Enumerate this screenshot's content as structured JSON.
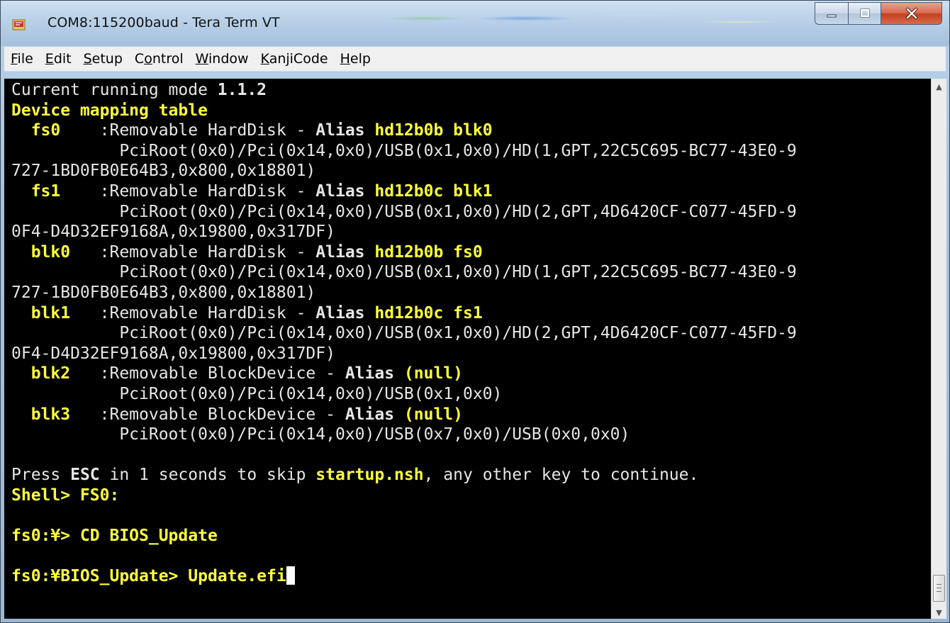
{
  "window": {
    "title": "COM8:115200baud - Tera Term VT"
  },
  "menu": {
    "items": [
      {
        "u": "F",
        "rest": "ile"
      },
      {
        "u": "E",
        "rest": "dit"
      },
      {
        "u": "S",
        "rest": "etup"
      },
      {
        "pre": "C",
        "u": "o",
        "rest": "ntrol"
      },
      {
        "u": "W",
        "rest": "indow"
      },
      {
        "u": "K",
        "rest": "anjiCode"
      },
      {
        "u": "H",
        "rest": "elp"
      }
    ]
  },
  "terminal": {
    "lines": [
      [
        {
          "t": "Current running mode ",
          "c": "w"
        },
        {
          "t": "1.1.2",
          "c": "w",
          "b": true
        }
      ],
      [
        {
          "t": "Device mapping table",
          "c": "y",
          "b": true
        }
      ],
      [
        {
          "t": "  fs0",
          "c": "y",
          "b": true
        },
        {
          "t": "    :Removable HardDisk - ",
          "c": "w"
        },
        {
          "t": "Alias ",
          "c": "w",
          "b": true
        },
        {
          "t": "hd12b0b blk0",
          "c": "y",
          "b": true
        }
      ],
      [
        {
          "t": "           PciRoot(0x0)/Pci(0x14,0x0)/USB(0x1,0x0)/HD(1,GPT,22C5C695-BC77-43E0-9",
          "c": "w"
        }
      ],
      [
        {
          "t": "727-1BD0FB0E64B3,0x800,0x18801)",
          "c": "w"
        }
      ],
      [
        {
          "t": "  fs1",
          "c": "y",
          "b": true
        },
        {
          "t": "    :Removable HardDisk - ",
          "c": "w"
        },
        {
          "t": "Alias ",
          "c": "w",
          "b": true
        },
        {
          "t": "hd12b0c blk1",
          "c": "y",
          "b": true
        }
      ],
      [
        {
          "t": "           PciRoot(0x0)/Pci(0x14,0x0)/USB(0x1,0x0)/HD(2,GPT,4D6420CF-C077-45FD-9",
          "c": "w"
        }
      ],
      [
        {
          "t": "0F4-D4D32EF9168A,0x19800,0x317DF)",
          "c": "w"
        }
      ],
      [
        {
          "t": "  blk0",
          "c": "y",
          "b": true
        },
        {
          "t": "   :Removable HardDisk - ",
          "c": "w"
        },
        {
          "t": "Alias ",
          "c": "w",
          "b": true
        },
        {
          "t": "hd12b0b fs0",
          "c": "y",
          "b": true
        }
      ],
      [
        {
          "t": "           PciRoot(0x0)/Pci(0x14,0x0)/USB(0x1,0x0)/HD(1,GPT,22C5C695-BC77-43E0-9",
          "c": "w"
        }
      ],
      [
        {
          "t": "727-1BD0FB0E64B3,0x800,0x18801)",
          "c": "w"
        }
      ],
      [
        {
          "t": "  blk1",
          "c": "y",
          "b": true
        },
        {
          "t": "   :Removable HardDisk - ",
          "c": "w"
        },
        {
          "t": "Alias ",
          "c": "w",
          "b": true
        },
        {
          "t": "hd12b0c fs1",
          "c": "y",
          "b": true
        }
      ],
      [
        {
          "t": "           PciRoot(0x0)/Pci(0x14,0x0)/USB(0x1,0x0)/HD(2,GPT,4D6420CF-C077-45FD-9",
          "c": "w"
        }
      ],
      [
        {
          "t": "0F4-D4D32EF9168A,0x19800,0x317DF)",
          "c": "w"
        }
      ],
      [
        {
          "t": "  blk2",
          "c": "y",
          "b": true
        },
        {
          "t": "   :Removable BlockDevice - ",
          "c": "w"
        },
        {
          "t": "Alias ",
          "c": "w",
          "b": true
        },
        {
          "t": "(null)",
          "c": "y",
          "b": true
        }
      ],
      [
        {
          "t": "           PciRoot(0x0)/Pci(0x14,0x0)/USB(0x1,0x0)",
          "c": "w"
        }
      ],
      [
        {
          "t": "  blk3",
          "c": "y",
          "b": true
        },
        {
          "t": "   :Removable BlockDevice - ",
          "c": "w"
        },
        {
          "t": "Alias ",
          "c": "w",
          "b": true
        },
        {
          "t": "(null)",
          "c": "y",
          "b": true
        }
      ],
      [
        {
          "t": "           PciRoot(0x0)/Pci(0x14,0x0)/USB(0x7,0x0)/USB(0x0,0x0)",
          "c": "w"
        }
      ],
      [
        {
          "t": "",
          "c": "w"
        }
      ],
      [
        {
          "t": "Press ",
          "c": "w"
        },
        {
          "t": "ESC",
          "c": "w",
          "b": true
        },
        {
          "t": " in 1 seconds to skip ",
          "c": "w"
        },
        {
          "t": "startup.nsh",
          "c": "y",
          "b": true
        },
        {
          "t": ", any other key to continue.",
          "c": "w"
        }
      ],
      [
        {
          "t": "Shell> FS0:",
          "c": "y",
          "b": true
        }
      ],
      [
        {
          "t": "",
          "c": "w"
        }
      ],
      [
        {
          "t": "fs0:¥> CD BIOS_Update",
          "c": "y",
          "b": true
        }
      ],
      [
        {
          "t": "",
          "c": "w"
        }
      ],
      [
        {
          "t": "fs0:¥BIOS_Update> Update.efi",
          "c": "y",
          "b": true,
          "cursor": true
        }
      ]
    ]
  },
  "colors": {
    "terminal_bg": "#000000",
    "text_white": "#e6e6e6",
    "text_yellow": "#ffff3c"
  },
  "icons": {
    "app": "tera-term-icon",
    "minimize": "minimize-icon",
    "maximize": "maximize-icon",
    "close": "close-icon",
    "scroll_up": "scroll-up-icon",
    "scroll_down": "scroll-down-icon"
  }
}
